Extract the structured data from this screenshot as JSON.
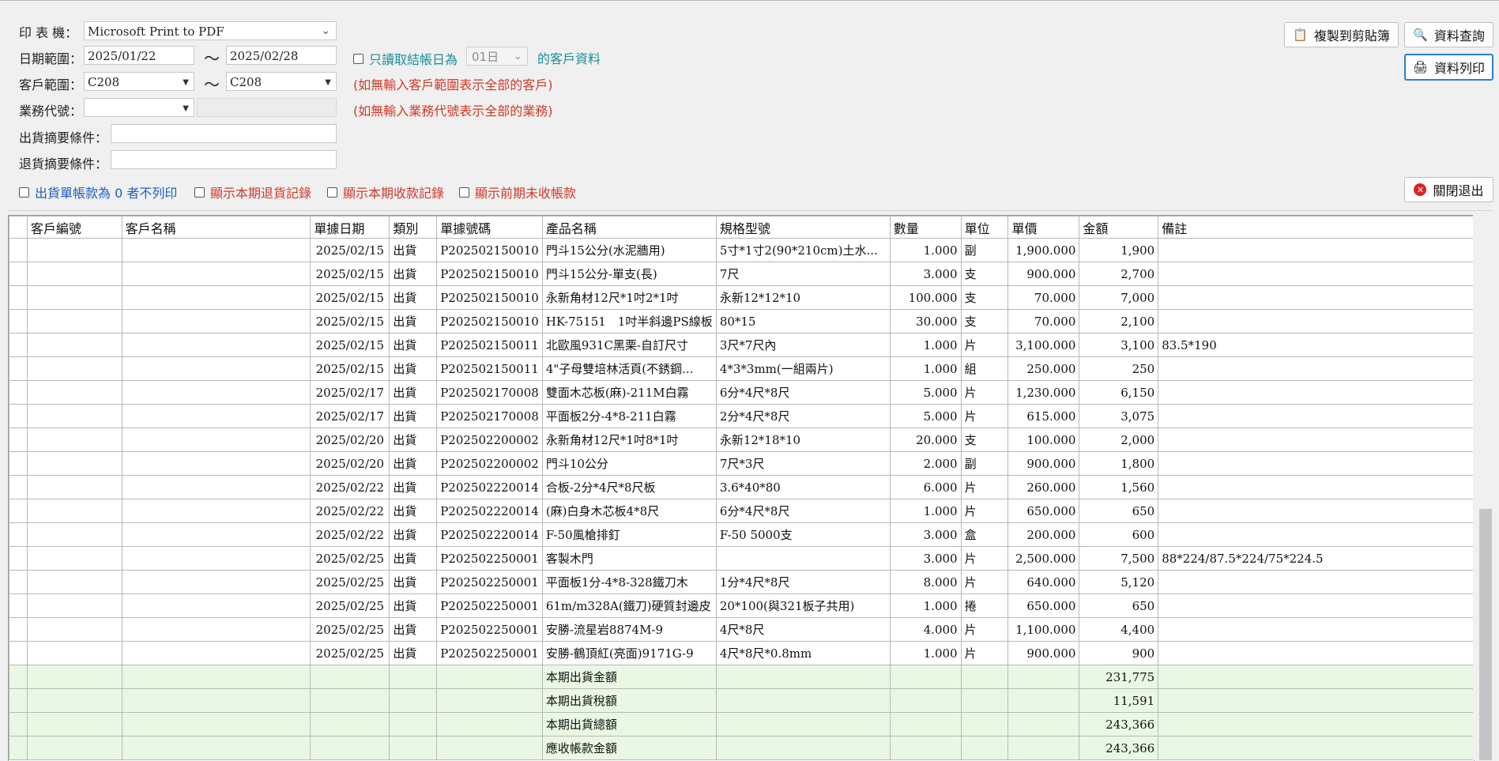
{
  "filters": {
    "printer_label": "印 表 機：",
    "printer_value": "Microsoft Print to PDF",
    "date_label": "日期範圍：",
    "date_from": "2025/01/22",
    "date_to": "2025/02/28",
    "tilde": "～",
    "customer_label": "客戶範圍：",
    "customer_from": "C208",
    "customer_to": "C208",
    "sales_label": "業務代號：",
    "sales_value": "",
    "sales_name": "",
    "ship_memo_label": "出貨摘要條件：",
    "ship_memo_value": "",
    "return_memo_label": "退貨摘要條件：",
    "return_memo_value": "",
    "closing_only_label": "只讀取結帳日為",
    "closing_day": "01日",
    "closing_suffix": "的客戶資料",
    "hint_customer": "(如無輸入客戶範圍表示全部的客戶)",
    "hint_sales": "(如無輸入業務代號表示全部的業務)",
    "opt_zero": "出貨單帳款為 0 者不列印",
    "opt_returns": "顯示本期退貨記錄",
    "opt_receipts": "顯示本期收款記錄",
    "opt_prev": "顯示前期未收帳款"
  },
  "buttons": {
    "copy": "複製到剪貼簿",
    "query": "資料查詢",
    "print": "資料列印",
    "exit": "關閉退出"
  },
  "table": {
    "headers": [
      "客戶編號",
      "客戶名稱",
      "單據日期",
      "類別",
      "單據號碼",
      "產品名稱",
      "規格型號",
      "數量",
      "單位",
      "單價",
      "金額",
      "備註"
    ],
    "rows": [
      [
        "",
        "",
        "2025/02/15",
        "出貨",
        "P202502150010",
        "門斗15公分(水泥牆用)",
        "5寸*1寸2(90*210cm)土水...",
        "1.000",
        "副",
        "1,900.000",
        "1,900",
        ""
      ],
      [
        "",
        "",
        "2025/02/15",
        "出貨",
        "P202502150010",
        "門斗15公分-單支(長)",
        "7尺",
        "3.000",
        "支",
        "900.000",
        "2,700",
        ""
      ],
      [
        "",
        "",
        "2025/02/15",
        "出貨",
        "P202502150010",
        "永新角材12尺*1吋2*1吋",
        "永新12*12*10",
        "100.000",
        "支",
        "70.000",
        "7,000",
        ""
      ],
      [
        "",
        "",
        "2025/02/15",
        "出貨",
        "P202502150010",
        "HK-75151　1吋半斜邊PS線板",
        "80*15",
        "30.000",
        "支",
        "70.000",
        "2,100",
        ""
      ],
      [
        "",
        "",
        "2025/02/15",
        "出貨",
        "P202502150011",
        "北歐風931C黑栗-自訂尺寸",
        "3尺*7尺內",
        "1.000",
        "片",
        "3,100.000",
        "3,100",
        "83.5*190"
      ],
      [
        "",
        "",
        "2025/02/15",
        "出貨",
        "P202502150011",
        "4\"子母雙培林活頁(不銹鋼...",
        "4*3*3mm(一組兩片)",
        "1.000",
        "組",
        "250.000",
        "250",
        ""
      ],
      [
        "",
        "",
        "2025/02/17",
        "出貨",
        "P202502170008",
        "雙面木芯板(麻)-211M白霧",
        "6分*4尺*8尺",
        "5.000",
        "片",
        "1,230.000",
        "6,150",
        ""
      ],
      [
        "",
        "",
        "2025/02/17",
        "出貨",
        "P202502170008",
        "平面板2分-4*8-211白霧",
        "2分*4尺*8尺",
        "5.000",
        "片",
        "615.000",
        "3,075",
        ""
      ],
      [
        "",
        "",
        "2025/02/20",
        "出貨",
        "P202502200002",
        "永新角材12尺*1吋8*1吋",
        "永新12*18*10",
        "20.000",
        "支",
        "100.000",
        "2,000",
        ""
      ],
      [
        "",
        "",
        "2025/02/20",
        "出貨",
        "P202502200002",
        "門斗10公分",
        "7尺*3尺",
        "2.000",
        "副",
        "900.000",
        "1,800",
        ""
      ],
      [
        "",
        "",
        "2025/02/22",
        "出貨",
        "P202502220014",
        "合板-2分*4尺*8尺板",
        "3.6*40*80",
        "6.000",
        "片",
        "260.000",
        "1,560",
        ""
      ],
      [
        "",
        "",
        "2025/02/22",
        "出貨",
        "P202502220014",
        "(麻)白身木芯板4*8尺",
        "6分*4尺*8尺",
        "1.000",
        "片",
        "650.000",
        "650",
        ""
      ],
      [
        "",
        "",
        "2025/02/22",
        "出貨",
        "P202502220014",
        "F-50風槍排釘",
        "F-50 5000支",
        "3.000",
        "盒",
        "200.000",
        "600",
        ""
      ],
      [
        "",
        "",
        "2025/02/25",
        "出貨",
        "P202502250001",
        "客製木門",
        "",
        "3.000",
        "片",
        "2,500.000",
        "7,500",
        "88*224/87.5*224/75*224.5"
      ],
      [
        "",
        "",
        "2025/02/25",
        "出貨",
        "P202502250001",
        "平面板1分-4*8-328鐵刀木",
        "1分*4尺*8尺",
        "8.000",
        "片",
        "640.000",
        "5,120",
        ""
      ],
      [
        "",
        "",
        "2025/02/25",
        "出貨",
        "P202502250001",
        "61m/m328A(鐵刀)硬質封邊皮",
        "20*100(與321板子共用)",
        "1.000",
        "捲",
        "650.000",
        "650",
        ""
      ],
      [
        "",
        "",
        "2025/02/25",
        "出貨",
        "P202502250001",
        "安勝-流星岩8874M-9",
        "4尺*8尺",
        "4.000",
        "片",
        "1,100.000",
        "4,400",
        ""
      ],
      [
        "",
        "",
        "2025/02/25",
        "出貨",
        "P202502250001",
        "安勝-鶴頂紅(亮面)9171G-9",
        "4尺*8尺*0.8mm",
        "1.000",
        "片",
        "900.000",
        "900",
        ""
      ]
    ],
    "summary": [
      {
        "label": "本期出貨金額",
        "value": "231,775"
      },
      {
        "label": "本期出貨稅額",
        "value": "11,591"
      },
      {
        "label": "本期出貨總額",
        "value": "243,366"
      },
      {
        "label": "應收帳款金額",
        "value": "243,366"
      }
    ]
  }
}
